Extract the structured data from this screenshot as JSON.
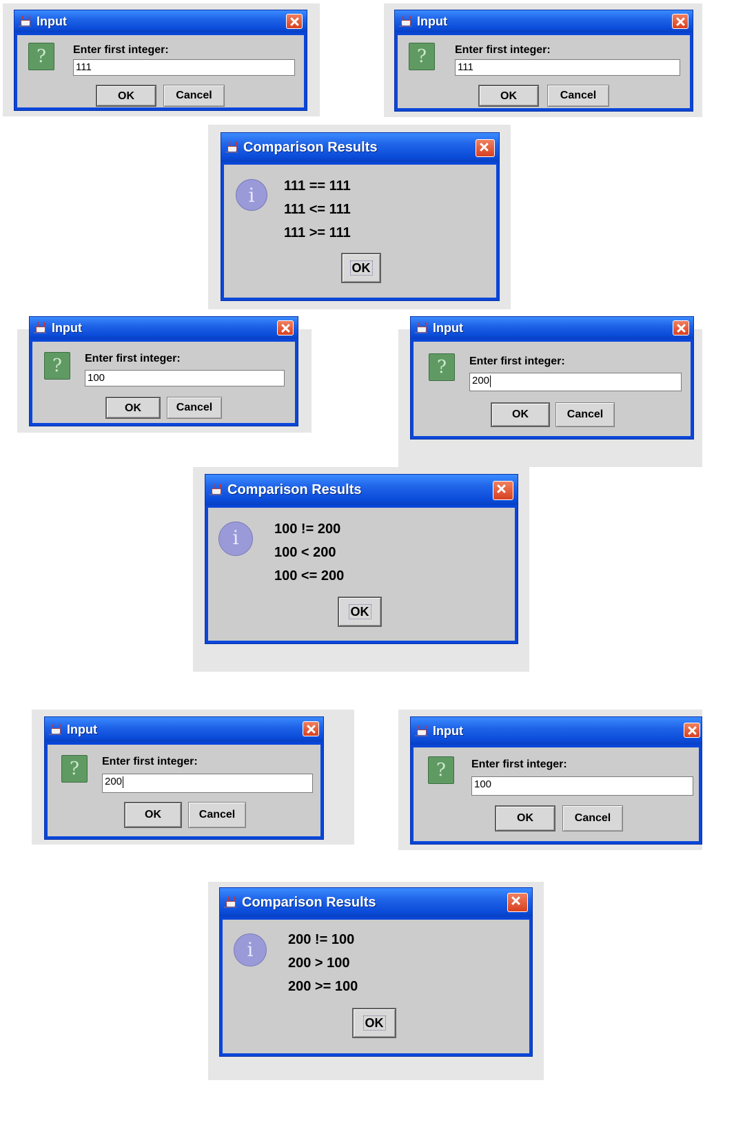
{
  "dialogs": {
    "in1": {
      "title": "Input",
      "prompt": "Enter first integer:",
      "value": "111",
      "ok": "OK",
      "cancel": "Cancel"
    },
    "in2": {
      "title": "Input",
      "prompt": "Enter first integer:",
      "value": "111",
      "ok": "OK",
      "cancel": "Cancel"
    },
    "res1": {
      "title": "Comparison Results",
      "lines": [
        "111 == 111",
        "111 <= 111",
        "111 >= 111"
      ],
      "ok": "OK"
    },
    "in3": {
      "title": "Input",
      "prompt": "Enter first integer:",
      "value": "100",
      "ok": "OK",
      "cancel": "Cancel"
    },
    "in4": {
      "title": "Input",
      "prompt": "Enter first integer:",
      "value": "200",
      "ok": "OK",
      "cancel": "Cancel"
    },
    "res2": {
      "title": "Comparison Results",
      "lines": [
        "100 != 200",
        "100 < 200",
        "100 <= 200"
      ],
      "ok": "OK"
    },
    "in5": {
      "title": "Input",
      "prompt": "Enter first integer:",
      "value": "200",
      "ok": "OK",
      "cancel": "Cancel"
    },
    "in6": {
      "title": "Input",
      "prompt": "Enter first integer:",
      "value": "100",
      "ok": "OK",
      "cancel": "Cancel"
    },
    "res3": {
      "title": "Comparison Results",
      "lines": [
        "200 != 100",
        "200 > 100",
        "200 >= 100"
      ],
      "ok": "OK"
    }
  },
  "icons": {
    "app": "java-cup-icon",
    "close": "close-icon",
    "question": "question-icon",
    "info": "info-icon"
  },
  "colors": {
    "titlebar": "#0a4ad8",
    "close": "#d84020",
    "body": "#cccccc",
    "question_icon": "#5f9a62",
    "info_icon": "#9a9ad8"
  }
}
